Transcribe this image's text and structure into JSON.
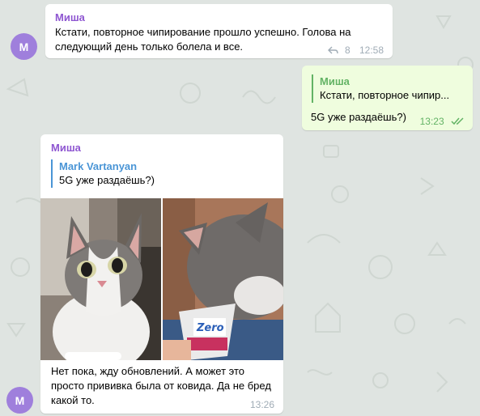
{
  "messages": [
    {
      "avatar_letter": "М",
      "sender": "Миша",
      "text": "Кстати, повторное чипирование прошло успешно. Голова на следующий день только болела и все.",
      "views": "8",
      "time": "12:58",
      "reply_icon": "reply-arrow-icon"
    },
    {
      "reply_to_name": "Миша",
      "reply_to_text": "Кстати, повторное чипир...",
      "text": "5G уже раздаёшь?)",
      "time": "13:23",
      "status_icon": "double-check-icon"
    },
    {
      "avatar_letter": "М",
      "sender": "Миша",
      "reply_to_name": "Mark Vartanyan",
      "reply_to_text": "5G уже раздаёшь?)",
      "photos": [
        {
          "description_icon": "cat-photo-icon",
          "label": ""
        },
        {
          "description_icon": "cat-eating-yogurt-photo-icon",
          "label": "Zero"
        }
      ],
      "text": "Нет пока, жду обновлений. А может это просто прививка была от ковида. Да не бред какой то.",
      "time": "13:26"
    }
  ],
  "colors": {
    "background": "#dfe4e1",
    "incoming_bubble": "#ffffff",
    "outgoing_bubble": "#effdde",
    "sender_name": "#8e56d1",
    "avatar": "#9f7fdc",
    "outgoing_accent": "#63b365",
    "reply_accent_blue": "#4a95d6"
  }
}
